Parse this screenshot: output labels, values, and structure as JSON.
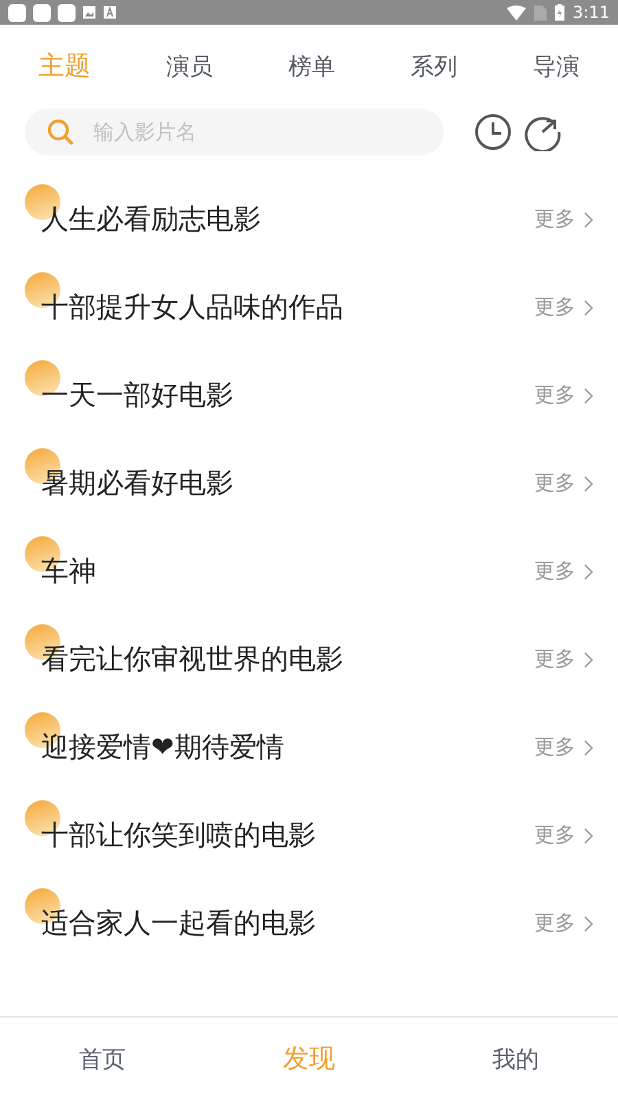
{
  "status_bar": {
    "time": "3:11"
  },
  "tabs": [
    {
      "label": "主题",
      "selected": true
    },
    {
      "label": "演员",
      "selected": false
    },
    {
      "label": "榜单",
      "selected": false
    },
    {
      "label": "系列",
      "selected": false
    },
    {
      "label": "导演",
      "selected": false
    }
  ],
  "search": {
    "placeholder": "输入影片名"
  },
  "topics": [
    {
      "title": "人生必看励志电影",
      "more": "更多"
    },
    {
      "title": "十部提升女人品味的作品",
      "more": "更多"
    },
    {
      "title": "一天一部好电影",
      "more": "更多"
    },
    {
      "title": "暑期必看好电影",
      "more": "更多"
    },
    {
      "title": "车神",
      "more": "更多"
    },
    {
      "title": "看完让你审视世界的电影",
      "more": "更多"
    },
    {
      "title": "迎接爱情❤期待爱情",
      "more": "更多"
    },
    {
      "title": "十部让你笑到喷的电影",
      "more": "更多"
    },
    {
      "title": "适合家人一起看的电影",
      "more": "更多"
    }
  ],
  "bottom_nav": [
    {
      "label": "首页",
      "selected": false
    },
    {
      "label": "发现",
      "selected": true
    },
    {
      "label": "我的",
      "selected": false
    }
  ]
}
